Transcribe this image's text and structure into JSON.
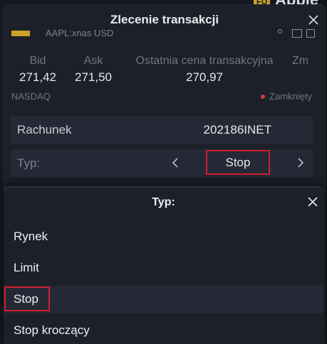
{
  "background": {
    "brand_tag": "FO",
    "brand_name": "Apple In"
  },
  "dialog": {
    "title": "Zlecenie transakcji",
    "symbol": "AAPL:xnas USD",
    "quotes": [
      {
        "label": "Bid",
        "value": "271,42"
      },
      {
        "label": "Ask",
        "value": "271,50"
      },
      {
        "label": "Ostatnia cena transakcyjna",
        "value": "270,97"
      },
      {
        "label": "Zm",
        "value": ""
      }
    ],
    "exchange": "NASDAQ",
    "market_status": "Zamknięty",
    "account": {
      "label": "Rachunek",
      "value": "202186INET"
    },
    "order_type": {
      "label": "Typ:",
      "value": "Stop"
    }
  },
  "sheet": {
    "title": "Typ:",
    "options": [
      "Rynek",
      "Limit",
      "Stop",
      "Stop kroczący"
    ],
    "selected_index": 2
  },
  "colors": {
    "highlight_border": "#d0202c",
    "status_dot": "#d23b4a",
    "flag": "#c9a227"
  },
  "icons": [
    "close-icon",
    "chevron-left-icon",
    "chevron-right-icon"
  ]
}
